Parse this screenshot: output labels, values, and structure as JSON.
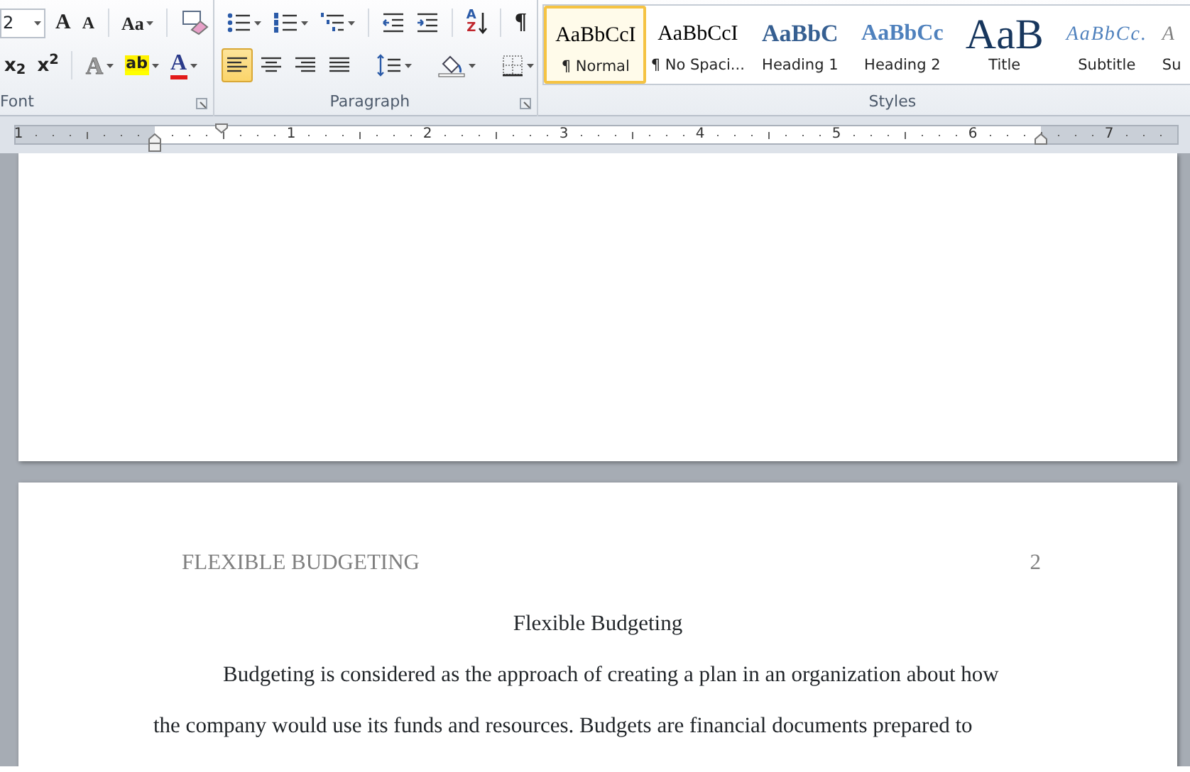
{
  "ribbon": {
    "font_group": {
      "label": "Font",
      "font_size": "2",
      "row_1": [
        {
          "kind": "grow",
          "glyph": "A"
        },
        {
          "kind": "shrink",
          "glyph": "A"
        },
        {
          "kind": "case",
          "glyph": "Aa"
        },
        {
          "kind": "clear"
        }
      ],
      "row_2": [
        {
          "kind": "subscript",
          "glyph": "x$_{2}$"
        },
        {
          "kind": "superscript",
          "glyph": "x$^{2}$"
        },
        {
          "kind": "effects",
          "glyph": "A"
        },
        {
          "kind": "highlight",
          "glyph": "ab"
        },
        {
          "kind": "font-color",
          "glyph": "A"
        }
      ]
    },
    "paragraph_group": {
      "label": "Paragraph",
      "row_1": [
        {
          "kind": "bullets"
        },
        {
          "kind": "numbering"
        },
        {
          "kind": "multilevel"
        },
        {
          "kind": "decrease-indent"
        },
        {
          "kind": "increase-indent"
        },
        {
          "kind": "sort",
          "glyphs": [
            "A",
            "Z"
          ]
        },
        {
          "kind": "pilcrow",
          "glyph": "¶"
        }
      ],
      "alignment": [
        {
          "kind": "left",
          "selected": true
        },
        {
          "kind": "center",
          "selected": false
        },
        {
          "kind": "right",
          "selected": false
        },
        {
          "kind": "justify",
          "selected": false
        }
      ],
      "row_2": [
        {
          "kind": "line-spacing"
        },
        {
          "kind": "shading"
        },
        {
          "kind": "borders"
        }
      ]
    },
    "styles_group": {
      "label": "Styles",
      "items": [
        {
          "kind": "normal",
          "preview": "AaBbCcI",
          "name": "¶ Normal",
          "selected": true
        },
        {
          "kind": "no-spacing",
          "preview": "AaBbCcI",
          "name": "¶ No Spaci...",
          "selected": false
        },
        {
          "kind": "heading-1",
          "preview": "AaBbC",
          "name": "Heading 1",
          "selected": false
        },
        {
          "kind": "heading-2",
          "preview": "AaBbCc",
          "name": "Heading 2",
          "selected": false
        },
        {
          "kind": "title",
          "preview": "AaB",
          "name": "Title",
          "selected": false
        },
        {
          "kind": "subtitle",
          "preview": "AaBbCc.",
          "name": "Subtitle",
          "selected": false
        },
        {
          "kind": "subtle",
          "preview": "A",
          "name": "Su",
          "selected": false
        }
      ]
    }
  },
  "ruler": {
    "numbers": [
      "1",
      "1",
      "2",
      "3",
      "4",
      "5",
      "6",
      "7"
    ]
  },
  "document": {
    "header": "FLEXIBLE BUDGETING",
    "page_number": "2",
    "title": "Flexible Budgeting",
    "body_lines": [
      {
        "text": "Budgeting is considered as the approach of creating a plan in an organization about how",
        "indent": true
      },
      {
        "text": "the company would use its funds and resources. Budgets are financial documents prepared to",
        "indent": false
      }
    ]
  }
}
